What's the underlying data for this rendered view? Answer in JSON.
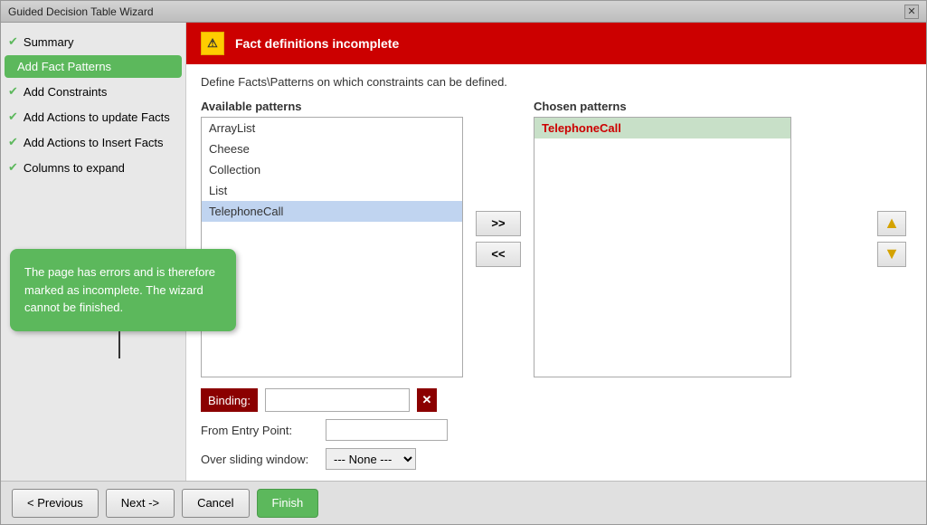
{
  "window": {
    "title": "Guided Decision Table Wizard",
    "close_label": "✕"
  },
  "sidebar": {
    "items": [
      {
        "id": "summary",
        "label": "Summary",
        "checked": true,
        "active": false
      },
      {
        "id": "add-fact-patterns",
        "label": "Add Fact Patterns",
        "checked": false,
        "active": true
      },
      {
        "id": "add-constraints",
        "label": "Add Constraints",
        "checked": true,
        "active": false
      },
      {
        "id": "add-actions-update",
        "label": "Add Actions to update Facts",
        "checked": true,
        "active": false
      },
      {
        "id": "add-actions-insert",
        "label": "Add Actions to Insert Facts",
        "checked": true,
        "active": false
      },
      {
        "id": "columns-expand",
        "label": "Columns to expand",
        "checked": true,
        "active": false
      }
    ]
  },
  "tooltip": {
    "text": "The page has errors and is therefore marked as incomplete. The wizard cannot be finished."
  },
  "error_banner": {
    "title": "Fact definitions incomplete",
    "icon": "⚠"
  },
  "main": {
    "define_text": "Define Facts\\Patterns on which constraints can be defined.",
    "available_patterns_label": "Available patterns",
    "chosen_patterns_label": "Chosen patterns",
    "available_items": [
      {
        "label": "ArrayList",
        "selected": false
      },
      {
        "label": "Cheese",
        "selected": false
      },
      {
        "label": "Collection",
        "selected": false
      },
      {
        "label": "List",
        "selected": false
      },
      {
        "label": "TelephoneCall",
        "selected": true
      }
    ],
    "chosen_items": [
      {
        "label": "TelephoneCall",
        "highlighted": true
      }
    ],
    "move_right_label": ">>",
    "move_left_label": "<<",
    "move_up_label": "▲",
    "move_down_label": "▼",
    "binding_label": "Binding:",
    "binding_x": "✕",
    "from_entry_label": "From Entry Point:",
    "over_sliding_label": "Over sliding window:",
    "sliding_default": "--- None ---"
  },
  "footer": {
    "previous_label": "< Previous",
    "next_label": "Next ->",
    "cancel_label": "Cancel",
    "finish_label": "Finish"
  }
}
